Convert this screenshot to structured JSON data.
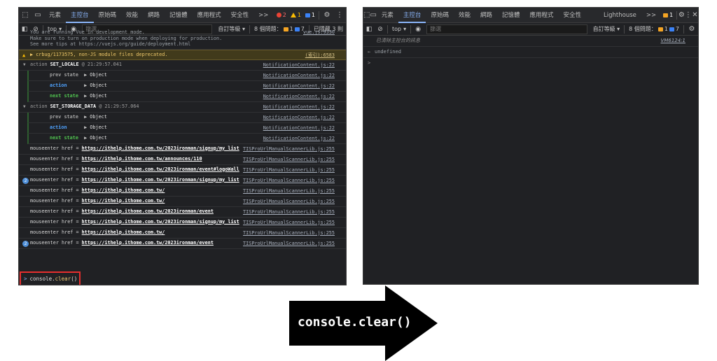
{
  "left": {
    "tabs": [
      "元素",
      "主控台",
      "原始碼",
      "效能",
      "網路",
      "記憶體",
      "應用程式",
      "安全性"
    ],
    "active_tab": 1,
    "more": ">>",
    "error_count": "2",
    "warn_count": "1",
    "info_count": "1",
    "filter": {
      "context": "top",
      "placeholder": "篩選",
      "levels": "自訂等級",
      "issues_label": "8 個問題：",
      "issue_warn": "1",
      "issue_info": "7",
      "hidden": "已隱藏 3 則"
    },
    "lines": {
      "l0": "You are running Vue in development mode.\nMake sure to turn on production mode when deploying for production.\nSee more tips at https://vuejs.org/guide/deployment.html",
      "l0_src": "vue.js:9330",
      "l1": "crbug/1173575, non-JS module files deprecated.",
      "l1_src": "(索引):6583",
      "g1_prefix": "action",
      "g1_name": "SET_LOCALE",
      "g1_time": "@ 21:29:57.041",
      "g2_prefix": "action",
      "g2_name": "SET_STORAGE_DATA",
      "g2_time": "@ 21:29:57.064",
      "notif_src": "NotificationContent.js:22",
      "prev": "prev state",
      "action": "action",
      "next": "next state",
      "object": "Object",
      "me": "mouseenter href =",
      "me_src": "TISProUrlManualScannerLib.js:255",
      "url1": "https://ithelp.ithome.com.tw/2023ironman/signup/my_list",
      "url2": "https://ithelp.ithome.com.tw/announces/110",
      "url3": "https://ithelp.ithome.com.tw/2023ironman/event#logoWall",
      "url4": "https://ithelp.ithome.com.tw/2023ironman/signup/my_list",
      "url5": "https://ithelp.ithome.com.tw/",
      "url6": "https://ithelp.ithome.com.tw/",
      "url7": "https://ithelp.ithome.com.tw/2023ironman/event",
      "url8": "https://ithelp.ithome.com.tw/2023ironman/signup/my_list",
      "url9": "https://ithelp.ithome.com.tw/",
      "url10": "https://ithelp.ithome.com.tw/2023ironman/event",
      "rep1": "2",
      "rep2": "2"
    },
    "prompt": {
      "arrow": ">",
      "obj": "console.",
      "fn": "clear",
      "parens": "()"
    }
  },
  "right": {
    "tabs": [
      "元素",
      "主控台",
      "原始碼",
      "效能",
      "網路",
      "記憶體",
      "應用程式",
      "安全性",
      "Lighthouse"
    ],
    "active_tab": 1,
    "more": ">>",
    "info_count": "1",
    "filter": {
      "context": "top",
      "placeholder": "篩選",
      "levels": "自訂等級",
      "issues_label": "8 個問題：",
      "issue_warn": "1",
      "issue_info": "7"
    },
    "cleared": "已清除主控台的訊息",
    "cleared_src": "VM6124:1",
    "result": "undefined",
    "result_marker": "←",
    "prompt_marker": ">"
  },
  "arrow": {
    "label": "console.clear()",
    "color": "#000000"
  }
}
